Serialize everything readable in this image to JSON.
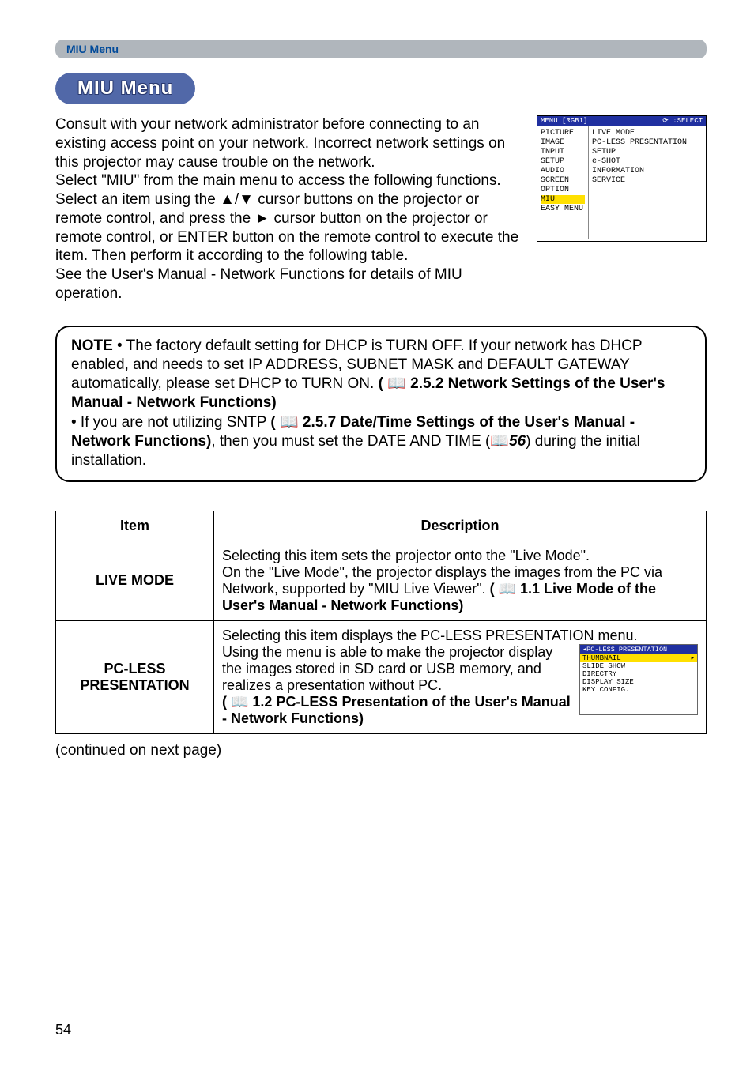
{
  "section_bar": "MIU Menu",
  "heading": "MIU Menu",
  "intro": {
    "p1": "Consult with your network administrator before connecting to an existing access point on your network. Incorrect network settings on this projector may cause trouble on the network.",
    "p2": "Select \"MIU\" from the main menu to access the following functions.",
    "p3a": "Select an item using the ",
    "p3b": " cursor buttons on the projector or remote control, and press the ",
    "p3c": " cursor button on the projector or remote control, or ENTER button on the remote control to execute the item. Then perform it according to the following table.",
    "arrows_ud": "▲/▼",
    "arrow_r": "►",
    "p4": "See the User's Manual - Network Functions for details of MIU operation."
  },
  "menu_screenshot": {
    "title_left": "MENU [RGB1]",
    "title_right": ":SELECT",
    "left_items": [
      "PICTURE",
      "IMAGE",
      "INPUT",
      "SETUP",
      "AUDIO",
      "SCREEN",
      "OPTION",
      "MIU",
      "EASY MENU"
    ],
    "left_highlight_index": 7,
    "right_items": [
      "LIVE MODE",
      "PC-LESS PRESENTATION",
      "SETUP",
      "e-SHOT",
      "INFORMATION",
      "SERVICE"
    ]
  },
  "note": {
    "label": "NOTE",
    "t1": "  • The factory default setting for DHCP is TURN OFF. If your network has DHCP enabled, and needs to set IP ADDRESS, SUBNET MASK and DEFAULT GATEWAY automatically, please set DHCP to TURN ON. ",
    "ref1": "( 📖 2.5.2 Network Settings of the User's Manual - Network Functions)",
    "t2": "• If you are not utilizing SNTP ",
    "ref2": "( 📖 2.5.7 Date/Time Settings of the User's Manual - Network Functions)",
    "t3": ", then you must set the DATE AND TIME (📖",
    "ref3_page": "56",
    "t4": ") during the initial installation."
  },
  "table": {
    "header_item": "Item",
    "header_desc": "Description",
    "rows": [
      {
        "item": "LIVE MODE",
        "desc_plain": "Selecting this item sets the projector onto the \"Live Mode\".\nOn the \"Live Mode\", the projector displays the images from the PC via Network, supported by \"MIU Live Viewer\". ",
        "desc_ref": "( 📖 1.1 Live Mode of the User's Manual - Network Functions)"
      },
      {
        "item": "PC-LESS PRESENTATION",
        "desc_line1": "Selecting this item displays the PC-LESS PRESENTATION menu.",
        "desc_plain": "Using the menu is able to make the projector display the images stored in SD card or USB memory, and realizes a presentation without PC. ",
        "desc_ref": "( 📖 1.2 PC-LESS Presentation of the User's Manual - Network Functions)",
        "submenu": {
          "header": "PC-LESS PRESENTATION",
          "highlight": "THUMBNAIL",
          "items": [
            "SLIDE SHOW",
            "DIRECTRY",
            "DISPLAY SIZE",
            "KEY CONFIG."
          ]
        }
      }
    ]
  },
  "continued": "(continued on next page)",
  "page_number": "54"
}
